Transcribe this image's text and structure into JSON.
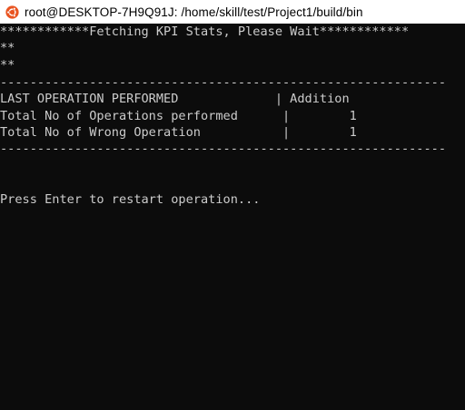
{
  "window": {
    "title": "root@DESKTOP-7H9Q91J: /home/skill/test/Project1/build/bin",
    "icon": "ubuntu-icon",
    "colors": {
      "titlebar_bg": "#ffffff",
      "terminal_bg": "#0c0c0c",
      "terminal_fg": "#cccccc",
      "icon_accent": "#e95420"
    }
  },
  "terminal": {
    "header_line": "************Fetching KPI Stats, Please Wait************",
    "marker_line_1": "**",
    "marker_line_2": "**",
    "divider_top": "------------------------------------------------------------",
    "stats": [
      {
        "text": "LAST OPERATION PERFORMED             | Addition"
      },
      {
        "text": "Total No of Operations performed      |        1"
      },
      {
        "text": "Total No of Wrong Operation           |        1"
      }
    ],
    "divider_bottom": "------------------------------------------------------------",
    "prompt_line": "Press Enter to restart operation..."
  }
}
